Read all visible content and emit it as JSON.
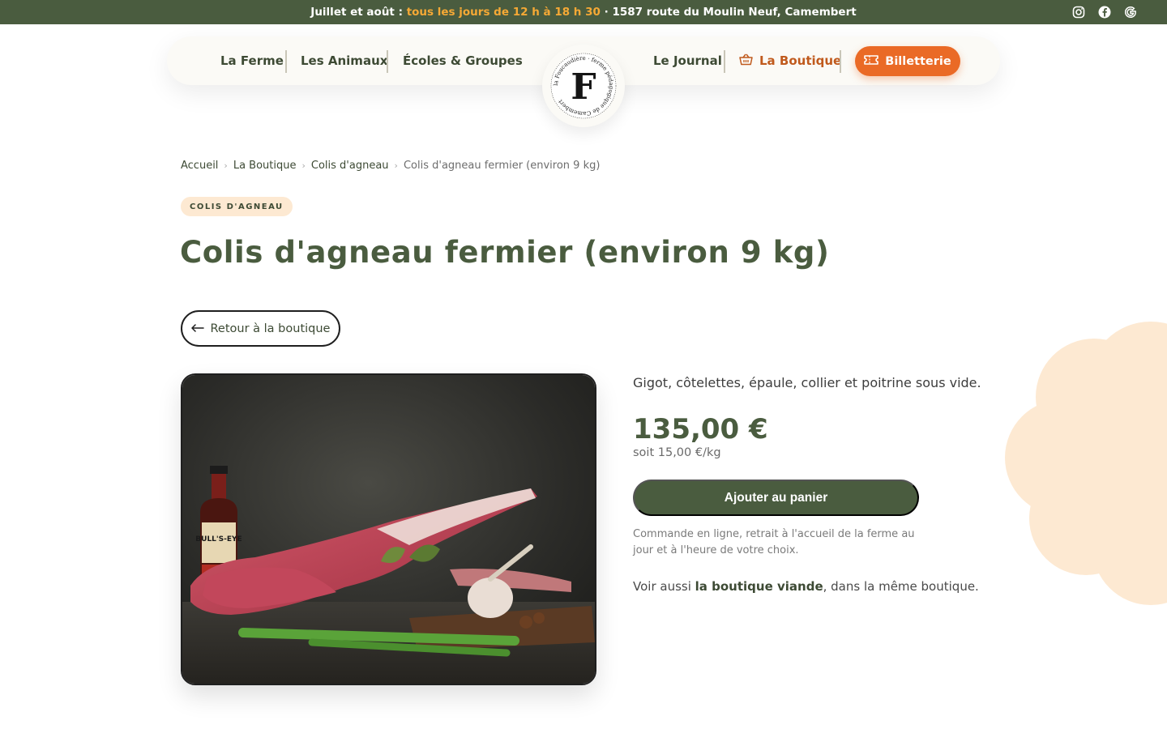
{
  "topbar": {
    "prefix": "Juillet et août :",
    "highlight": "tous les jours de 12 h à 18 h 30",
    "suffix": "· 1587 route du Moulin Neuf, Camembert",
    "socials": [
      "instagram-icon",
      "facebook-icon",
      "google-icon"
    ],
    "accent_color": "#f6a935",
    "bg_color": "#4a5c3f"
  },
  "nav": {
    "items": [
      "La Ferme",
      "Les Animaux",
      "Écoles & Groupes",
      "Le Journal"
    ],
    "shop": "La Boutique",
    "cta": "Billetterie"
  },
  "logo": {
    "letter": "F",
    "ring_text": "la Foucaudière · ferme pédagogique de Camembert"
  },
  "breadcrumb": [
    "Accueil",
    "La Boutique",
    "Colis d'agneau",
    "Colis d'agneau fermier (environ 9 kg)"
  ],
  "product": {
    "category": "COLIS D'AGNEAU",
    "title": "Colis d'agneau fermier (environ 9 kg)",
    "back": "Retour à la boutique",
    "description": "Gigot, côtelettes, épaule, collier et poitrine sous vide.",
    "price": "135,00 €",
    "per_kg": "soit 15,00 €/kg",
    "add_to_cart": "Ajouter au panier",
    "note": "Commande en ligne, retrait à l'accueil de la ferme au jour et à l'heure de votre choix.",
    "see_also_prefix": "Voir aussi",
    "see_also_link": "la boutique viande",
    "see_also_suffix": ", dans la même boutique.",
    "bottle_label": "BULL'S-EYE"
  },
  "colors": {
    "brand_green": "#4a5c3f",
    "orange": "#ea6a26",
    "shop_text": "#c05a1d",
    "cream": "#fde9d2"
  }
}
